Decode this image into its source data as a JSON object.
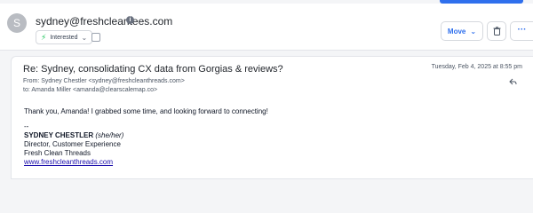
{
  "header": {
    "avatar_letter": "S",
    "sender_email": "sydney@freshcleantees.com",
    "status_label": "Interested",
    "move_label": "Move",
    "more_label": "···"
  },
  "email": {
    "subject": "Re: Sydney, consolidating CX data from Gorgias & reviews?",
    "date": "Tuesday, Feb 4, 2025 at 8:55 pm",
    "from_prefix": "From:",
    "from_value": "Sydney Chestler <sydney@freshcleanthreads.com>",
    "to_prefix": "to:",
    "to_value": "Amanda Miller <amanda@clearscalemap.co>",
    "body_line": "Thank you, Amanda! I grabbed some time, and looking forward to connecting!",
    "signature": {
      "dash": "--",
      "name": "SYDNEY CHESTLER",
      "pronouns": "(she/her)",
      "title": "Director, Customer Experience",
      "company": "Fresh Clean Threads",
      "website": "www.freshcleanthreads.com"
    }
  },
  "colors": {
    "accent": "#2f6fed",
    "status_icon": "#22c55e",
    "link": "#1a0dab"
  },
  "icons": [
    "info-icon",
    "bolt-icon",
    "chevron-down-icon",
    "calendar-icon",
    "trash-icon",
    "reply-icon"
  ]
}
